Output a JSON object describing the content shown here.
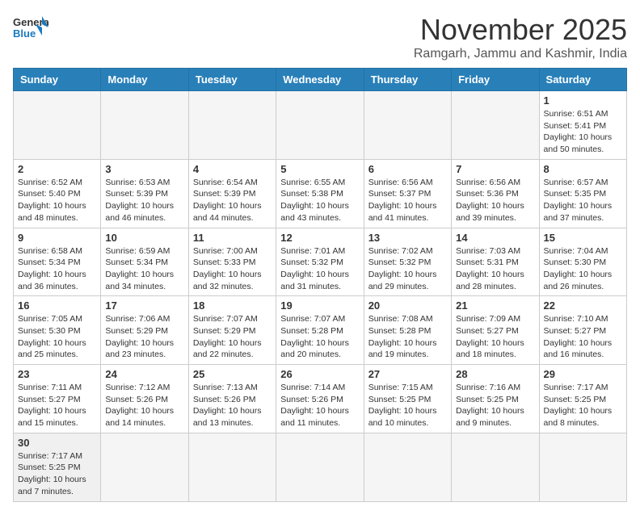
{
  "header": {
    "logo_general": "General",
    "logo_blue": "Blue",
    "month_title": "November 2025",
    "subtitle": "Ramgarh, Jammu and Kashmir, India"
  },
  "weekdays": [
    "Sunday",
    "Monday",
    "Tuesday",
    "Wednesday",
    "Thursday",
    "Friday",
    "Saturday"
  ],
  "weeks": [
    [
      {
        "day": "",
        "empty": true
      },
      {
        "day": "",
        "empty": true
      },
      {
        "day": "",
        "empty": true
      },
      {
        "day": "",
        "empty": true
      },
      {
        "day": "",
        "empty": true
      },
      {
        "day": "",
        "empty": true
      },
      {
        "day": "1",
        "sunrise": "6:51 AM",
        "sunset": "5:41 PM",
        "daylight": "10 hours and 50 minutes."
      }
    ],
    [
      {
        "day": "2",
        "sunrise": "6:52 AM",
        "sunset": "5:40 PM",
        "daylight": "10 hours and 48 minutes."
      },
      {
        "day": "3",
        "sunrise": "6:53 AM",
        "sunset": "5:39 PM",
        "daylight": "10 hours and 46 minutes."
      },
      {
        "day": "4",
        "sunrise": "6:54 AM",
        "sunset": "5:39 PM",
        "daylight": "10 hours and 44 minutes."
      },
      {
        "day": "5",
        "sunrise": "6:55 AM",
        "sunset": "5:38 PM",
        "daylight": "10 hours and 43 minutes."
      },
      {
        "day": "6",
        "sunrise": "6:56 AM",
        "sunset": "5:37 PM",
        "daylight": "10 hours and 41 minutes."
      },
      {
        "day": "7",
        "sunrise": "6:56 AM",
        "sunset": "5:36 PM",
        "daylight": "10 hours and 39 minutes."
      },
      {
        "day": "8",
        "sunrise": "6:57 AM",
        "sunset": "5:35 PM",
        "daylight": "10 hours and 37 minutes."
      }
    ],
    [
      {
        "day": "9",
        "sunrise": "6:58 AM",
        "sunset": "5:34 PM",
        "daylight": "10 hours and 36 minutes."
      },
      {
        "day": "10",
        "sunrise": "6:59 AM",
        "sunset": "5:34 PM",
        "daylight": "10 hours and 34 minutes."
      },
      {
        "day": "11",
        "sunrise": "7:00 AM",
        "sunset": "5:33 PM",
        "daylight": "10 hours and 32 minutes."
      },
      {
        "day": "12",
        "sunrise": "7:01 AM",
        "sunset": "5:32 PM",
        "daylight": "10 hours and 31 minutes."
      },
      {
        "day": "13",
        "sunrise": "7:02 AM",
        "sunset": "5:32 PM",
        "daylight": "10 hours and 29 minutes."
      },
      {
        "day": "14",
        "sunrise": "7:03 AM",
        "sunset": "5:31 PM",
        "daylight": "10 hours and 28 minutes."
      },
      {
        "day": "15",
        "sunrise": "7:04 AM",
        "sunset": "5:30 PM",
        "daylight": "10 hours and 26 minutes."
      }
    ],
    [
      {
        "day": "16",
        "sunrise": "7:05 AM",
        "sunset": "5:30 PM",
        "daylight": "10 hours and 25 minutes."
      },
      {
        "day": "17",
        "sunrise": "7:06 AM",
        "sunset": "5:29 PM",
        "daylight": "10 hours and 23 minutes."
      },
      {
        "day": "18",
        "sunrise": "7:07 AM",
        "sunset": "5:29 PM",
        "daylight": "10 hours and 22 minutes."
      },
      {
        "day": "19",
        "sunrise": "7:07 AM",
        "sunset": "5:28 PM",
        "daylight": "10 hours and 20 minutes."
      },
      {
        "day": "20",
        "sunrise": "7:08 AM",
        "sunset": "5:28 PM",
        "daylight": "10 hours and 19 minutes."
      },
      {
        "day": "21",
        "sunrise": "7:09 AM",
        "sunset": "5:27 PM",
        "daylight": "10 hours and 18 minutes."
      },
      {
        "day": "22",
        "sunrise": "7:10 AM",
        "sunset": "5:27 PM",
        "daylight": "10 hours and 16 minutes."
      }
    ],
    [
      {
        "day": "23",
        "sunrise": "7:11 AM",
        "sunset": "5:27 PM",
        "daylight": "10 hours and 15 minutes."
      },
      {
        "day": "24",
        "sunrise": "7:12 AM",
        "sunset": "5:26 PM",
        "daylight": "10 hours and 14 minutes."
      },
      {
        "day": "25",
        "sunrise": "7:13 AM",
        "sunset": "5:26 PM",
        "daylight": "10 hours and 13 minutes."
      },
      {
        "day": "26",
        "sunrise": "7:14 AM",
        "sunset": "5:26 PM",
        "daylight": "10 hours and 11 minutes."
      },
      {
        "day": "27",
        "sunrise": "7:15 AM",
        "sunset": "5:25 PM",
        "daylight": "10 hours and 10 minutes."
      },
      {
        "day": "28",
        "sunrise": "7:16 AM",
        "sunset": "5:25 PM",
        "daylight": "10 hours and 9 minutes."
      },
      {
        "day": "29",
        "sunrise": "7:17 AM",
        "sunset": "5:25 PM",
        "daylight": "10 hours and 8 minutes."
      }
    ],
    [
      {
        "day": "30",
        "sunrise": "7:17 AM",
        "sunset": "5:25 PM",
        "daylight": "10 hours and 7 minutes.",
        "lastrow": true
      },
      {
        "day": "",
        "empty": true,
        "lastrow": true
      },
      {
        "day": "",
        "empty": true,
        "lastrow": true
      },
      {
        "day": "",
        "empty": true,
        "lastrow": true
      },
      {
        "day": "",
        "empty": true,
        "lastrow": true
      },
      {
        "day": "",
        "empty": true,
        "lastrow": true
      },
      {
        "day": "",
        "empty": true,
        "lastrow": true
      }
    ]
  ],
  "labels": {
    "sunrise": "Sunrise:",
    "sunset": "Sunset:",
    "daylight": "Daylight:"
  }
}
